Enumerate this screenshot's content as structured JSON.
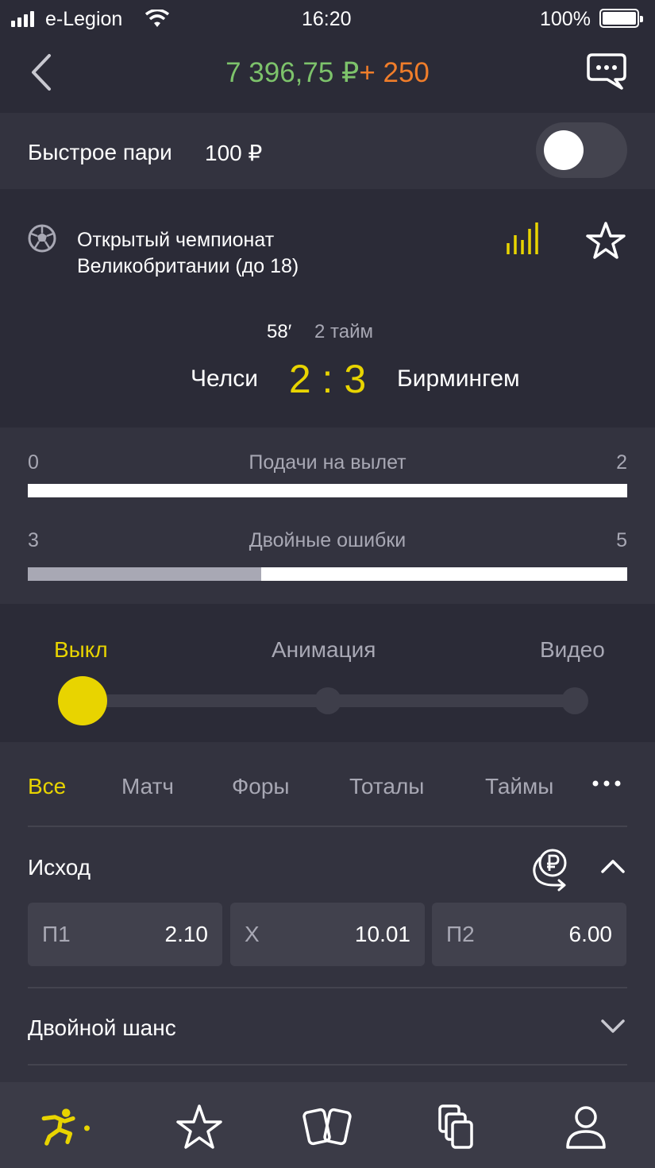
{
  "status_bar": {
    "carrier": "e-Legion",
    "time": "16:20",
    "battery": "100%"
  },
  "header": {
    "balance": "7 396,75 ₽",
    "bonus": "+ 250",
    "back_icon": "chevron-left-icon",
    "chat_icon": "chat-bubble-icon"
  },
  "quick_bet": {
    "label": "Быстрое пари",
    "amount": "100 ₽",
    "enabled": false
  },
  "match": {
    "sport_icon": "soccer-ball-icon",
    "league_line1": "Открытый чемпионат",
    "league_line2": "Великобритании (до 18)",
    "minute": "58′",
    "period": "2 тайм",
    "team1": "Челси",
    "score": "2 : 3",
    "team2": "Бирмингем"
  },
  "stats": [
    {
      "left": "0",
      "title": "Подачи на вылет",
      "right": "2",
      "left_share": 0.0
    },
    {
      "left": "3",
      "title": "Двойные ошибки",
      "right": "5",
      "left_share": 0.39
    }
  ],
  "broadcast_mode": {
    "options": [
      "Выкл",
      "Анимация",
      "Видео"
    ],
    "selected": "Выкл"
  },
  "market_tabs": [
    "Все",
    "Матч",
    "Форы",
    "Тоталы",
    "Таймы"
  ],
  "active_tab": "Все",
  "markets": {
    "outcome_title": "Исход",
    "outcomes": [
      {
        "name": "П1",
        "odd": "2.10"
      },
      {
        "name": "X",
        "odd": "10.01"
      },
      {
        "name": "П2",
        "odd": "6.00"
      }
    ],
    "double_chance_title": "Двойной шанс"
  },
  "colors": {
    "accent": "#e8d400",
    "balance": "#7dc36b",
    "bonus": "#f07d2a",
    "background": "#2b2b37",
    "panel": "#33333f"
  },
  "tabbar": {
    "items": [
      "sport-icon",
      "star-icon",
      "cards-icon",
      "coupons-icon",
      "profile-icon"
    ],
    "active": "sport-icon"
  }
}
